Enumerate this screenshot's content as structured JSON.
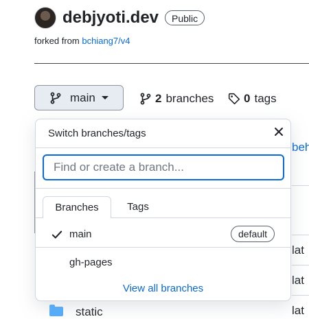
{
  "repo": {
    "name": "debjyoti.dev",
    "visibility": "Public",
    "forked_prefix": "forked from",
    "forked_source": "bchiang7/v4"
  },
  "branch_selector": {
    "current": "main"
  },
  "stats": {
    "branches_count": "2",
    "branches_label": "branches",
    "tags_count": "0",
    "tags_label": "tags"
  },
  "background": {
    "link_fragment": "beh",
    "row_text": [
      "lat",
      "lat",
      "lat"
    ],
    "folder_name": "static"
  },
  "dropdown": {
    "title": "Switch branches/tags",
    "search_placeholder": "Find or create a branch...",
    "tabs": [
      {
        "label": "Branches",
        "active": true
      },
      {
        "label": "Tags",
        "active": false
      }
    ],
    "branches": [
      {
        "name": "main",
        "selected": true,
        "badge": "default"
      },
      {
        "name": "gh-pages",
        "selected": false
      }
    ],
    "view_all": "View all branches"
  },
  "colors": {
    "link": "#0969da",
    "input_focus": "#0969da",
    "folder": "#54aeff"
  }
}
